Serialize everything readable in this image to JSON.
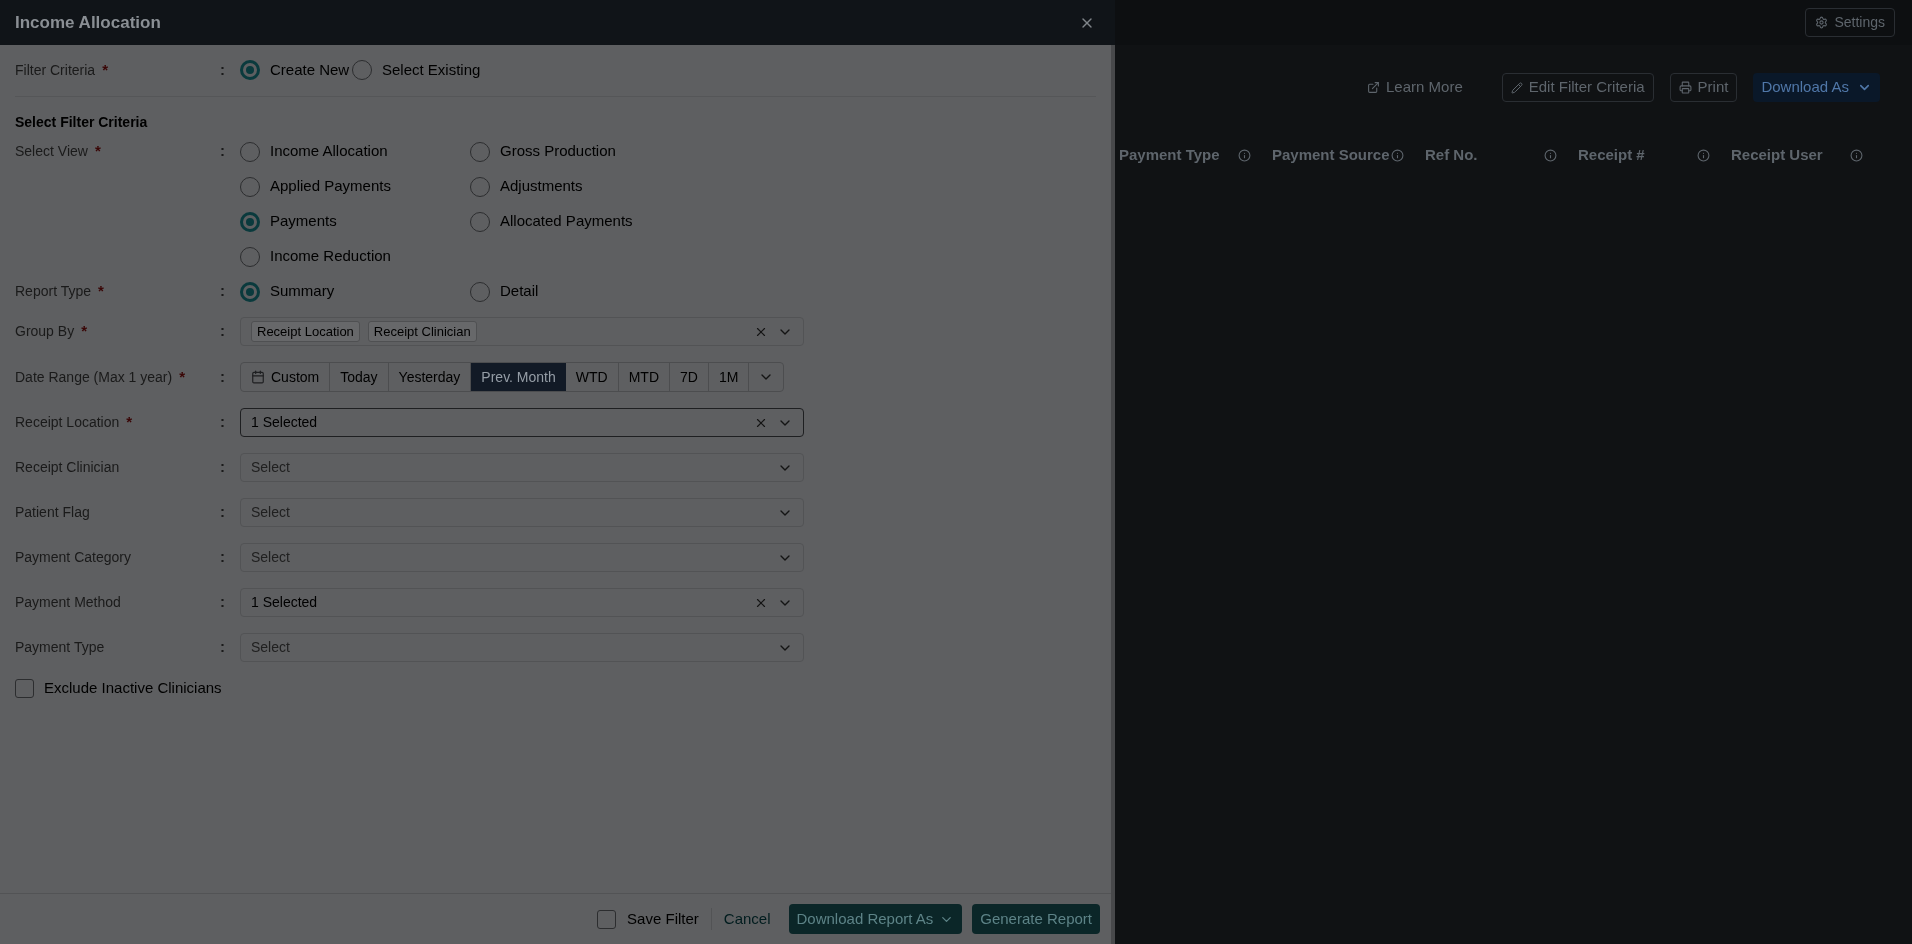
{
  "drawer": {
    "title": "Income Allocation",
    "filter_criteria": {
      "label": "Filter Criteria",
      "required_mark": "*",
      "separator": ":",
      "options": [
        {
          "label": "Create New",
          "selected": true
        },
        {
          "label": "Select Existing",
          "selected": false
        }
      ]
    },
    "section_title": "Select Filter Criteria",
    "rows": [
      {
        "kind": "radio",
        "label": "Select View",
        "required_mark": "*",
        "separator": ":",
        "options": [
          {
            "label": "Income Allocation",
            "selected": false
          },
          {
            "label": "Gross Production",
            "selected": false
          },
          {
            "label": "Applied Payments",
            "selected": false
          },
          {
            "label": "Adjustments",
            "selected": false
          },
          {
            "label": "Payments",
            "selected": true
          },
          {
            "label": "Allocated Payments",
            "selected": false
          },
          {
            "label": "Income Reduction",
            "selected": false
          }
        ]
      },
      {
        "kind": "radio",
        "label": "Report Type",
        "required_mark": "*",
        "separator": ":",
        "options": [
          {
            "label": "Summary",
            "selected": true
          },
          {
            "label": "Detail",
            "selected": false
          }
        ]
      },
      {
        "kind": "tags",
        "label": "Group By",
        "required_mark": "*",
        "separator": ":",
        "tags": [
          "Receipt Location",
          "Receipt Clinician"
        ],
        "clearable": true
      },
      {
        "kind": "segments",
        "label": "Date Range (Max 1 year)",
        "required_mark": "*",
        "separator": ":",
        "options": [
          {
            "kind": "picker",
            "label": "Custom",
            "selected": false
          },
          {
            "kind": "preset",
            "label": "Today",
            "selected": false
          },
          {
            "kind": "preset",
            "label": "Yesterday",
            "selected": false
          },
          {
            "kind": "preset",
            "label": "Prev. Month",
            "selected": true
          },
          {
            "kind": "preset",
            "label": "WTD",
            "selected": false
          },
          {
            "kind": "preset",
            "label": "MTD",
            "selected": false
          },
          {
            "kind": "preset",
            "label": "7D",
            "selected": false
          },
          {
            "kind": "preset",
            "label": "1M",
            "selected": false
          }
        ]
      },
      {
        "kind": "select",
        "label": "Receipt Location",
        "required_mark": "*",
        "separator": ":",
        "value": "1 Selected",
        "clearable": true,
        "active": true
      },
      {
        "kind": "select",
        "label": "Receipt Clinician",
        "separator": ":",
        "placeholder": "Select",
        "clearable": false,
        "active": false
      },
      {
        "kind": "select",
        "label": "Patient Flag",
        "separator": ":",
        "placeholder": "Select",
        "clearable": false,
        "active": false
      },
      {
        "kind": "select",
        "label": "Payment Category",
        "separator": ":",
        "placeholder": "Select",
        "clearable": false,
        "active": false
      },
      {
        "kind": "select",
        "label": "Payment Method",
        "separator": ":",
        "value": "1 Selected",
        "clearable": true,
        "active": false
      },
      {
        "kind": "select",
        "label": "Payment Type",
        "separator": ":",
        "placeholder": "Select",
        "clearable": false,
        "active": false
      }
    ],
    "exclude_inactive": {
      "label": "Exclude Inactive Clinicians",
      "checked": false
    },
    "footer": {
      "save_filter": {
        "label": "Save Filter",
        "checked": false
      },
      "cancel": "Cancel",
      "download": "Download Report As",
      "generate": "Generate Report"
    }
  },
  "background_page": {
    "settings": "Settings",
    "toolbar": {
      "learn_more": "Learn More",
      "edit_filter": "Edit Filter Criteria",
      "print": "Print",
      "download": "Download As"
    },
    "table": {
      "columns": [
        "Payment Type",
        "Payment Source",
        "Ref No.",
        "Receipt #",
        "Receipt User"
      ]
    }
  }
}
